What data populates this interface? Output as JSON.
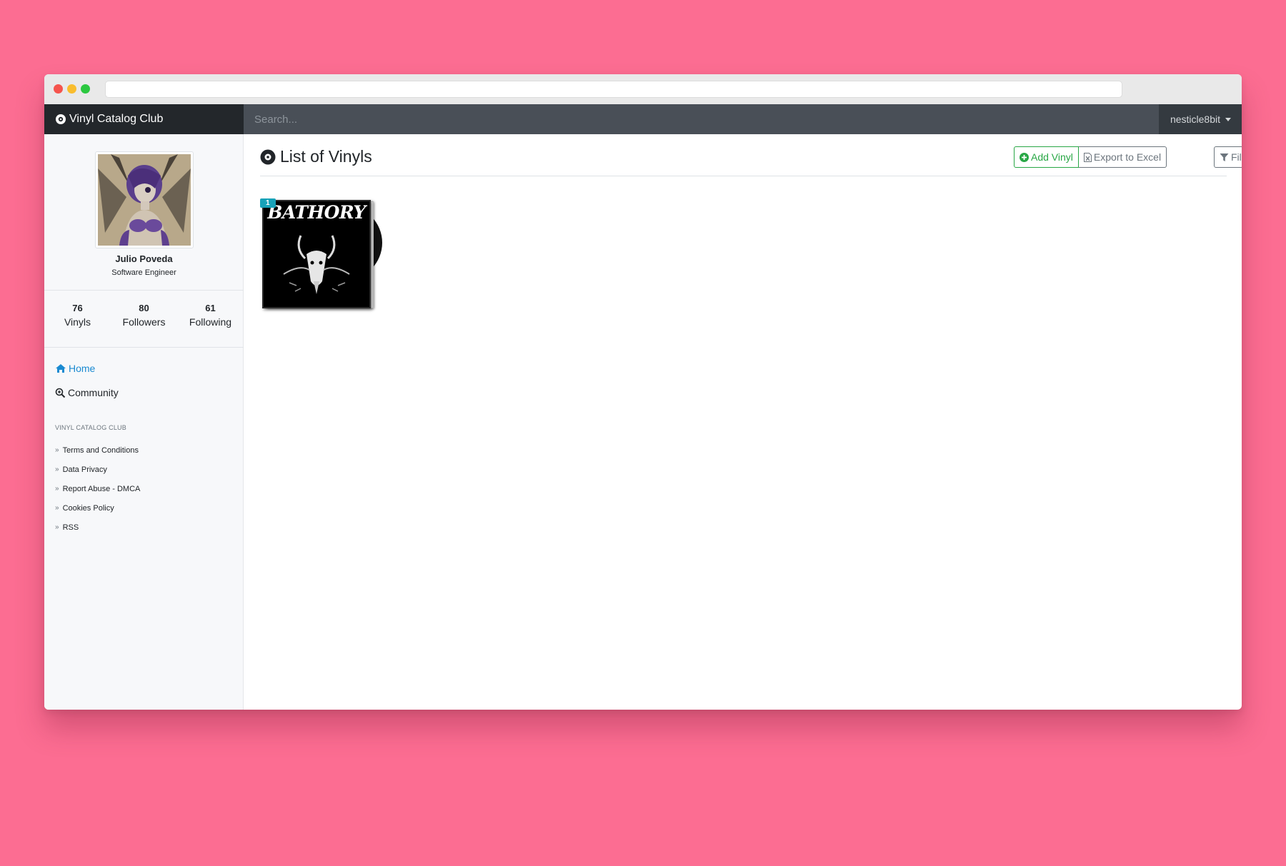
{
  "app": {
    "brand": "Vinyl Catalog Club"
  },
  "search": {
    "placeholder": "Search..."
  },
  "user": {
    "name": "nesticle8bit"
  },
  "profile": {
    "name": "Julio Poveda",
    "title": "Software Engineer",
    "stats": [
      {
        "value": "76",
        "label": "Vinyls"
      },
      {
        "value": "80",
        "label": "Followers"
      },
      {
        "value": "61",
        "label": "Following"
      }
    ]
  },
  "nav": {
    "home": "Home",
    "community": "Community"
  },
  "footer": {
    "section": "VINYL CATALOG CLUB",
    "links": [
      "Terms and Conditions",
      "Data Privacy",
      "Report Abuse - DMCA",
      "Cookies Policy",
      "RSS"
    ]
  },
  "main": {
    "title": "List of Vinyls",
    "add_label": "Add Vinyl",
    "export_label": "Export to Excel",
    "filter_label": "Filter"
  },
  "vinyls": [
    {
      "badge": "1",
      "cover_text": "BATHORY"
    }
  ],
  "colors": {
    "background": "#fc6d92",
    "navbar": "#343a40",
    "brand_bg": "#23272b",
    "accent": "#1a8ad1",
    "success": "#28a745",
    "badge": "#17a2b8"
  }
}
